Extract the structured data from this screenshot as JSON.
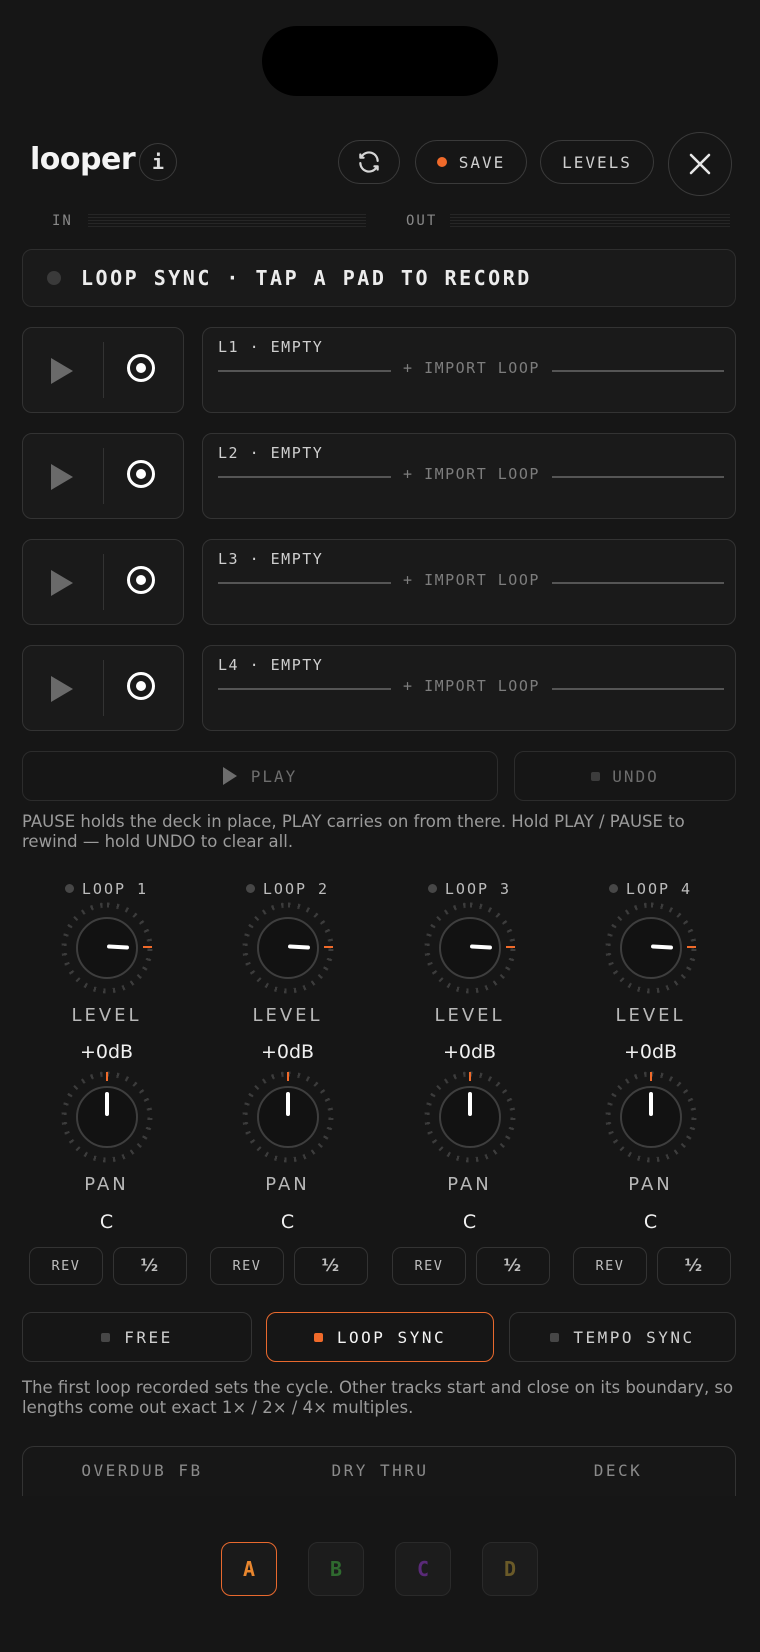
{
  "app": {
    "title": "looper",
    "info_icon": "i"
  },
  "toolbar": {
    "save_label": "SAVE",
    "levels_label": "LEVELS",
    "save_dot_color": "#f06a2a"
  },
  "meters": {
    "in_label": "IN",
    "out_label": "OUT"
  },
  "status": {
    "text": "LOOP SYNC · TAP A PAD TO RECORD"
  },
  "lanes": [
    {
      "label": "L1 · EMPTY",
      "import": "IMPORT LOOP"
    },
    {
      "label": "L2 · EMPTY",
      "import": "IMPORT LOOP"
    },
    {
      "label": "L3 · EMPTY",
      "import": "IMPORT LOOP"
    },
    {
      "label": "L4 · EMPTY",
      "import": "IMPORT LOOP"
    }
  ],
  "transport": {
    "play_label": "PLAY",
    "undo_label": "UNDO",
    "help": "PAUSE holds the deck in place, PLAY carries on from there. Hold PLAY / PAUSE to rewind — hold UNDO to clear all."
  },
  "mixer": [
    {
      "name": "LOOP 1",
      "level_label": "LEVEL",
      "level_value": "+0dB",
      "pan_label": "PAN",
      "pan_value": "C",
      "rev_label": "REV",
      "half_label": "½"
    },
    {
      "name": "LOOP 2",
      "level_label": "LEVEL",
      "level_value": "+0dB",
      "pan_label": "PAN",
      "pan_value": "C",
      "rev_label": "REV",
      "half_label": "½"
    },
    {
      "name": "LOOP 3",
      "level_label": "LEVEL",
      "level_value": "+0dB",
      "pan_label": "PAN",
      "pan_value": "C",
      "rev_label": "REV",
      "half_label": "½"
    },
    {
      "name": "LOOP 4",
      "level_label": "LEVEL",
      "level_value": "+0dB",
      "pan_label": "PAN",
      "pan_value": "C",
      "rev_label": "REV",
      "half_label": "½"
    }
  ],
  "modes": {
    "items": [
      "FREE",
      "LOOP SYNC",
      "TEMPO SYNC"
    ],
    "selected": "LOOP SYNC",
    "help": "The first loop recorded sets the cycle. Other tracks start and close on its boundary, so lengths come out exact 1× / 2× / 4× multiples."
  },
  "settings": {
    "overdub_label": "OVERDUB FB",
    "dry_label": "DRY THRU",
    "deck_label": "DECK"
  },
  "banks": {
    "items": [
      {
        "label": "A",
        "color": "#e8862e"
      },
      {
        "label": "B",
        "color": "#2f6a2f"
      },
      {
        "label": "C",
        "color": "#5a2a78"
      },
      {
        "label": "D",
        "color": "#6a5a28"
      }
    ],
    "selected": "A"
  },
  "colors": {
    "accent": "#f06a2a",
    "background": "#161616"
  }
}
